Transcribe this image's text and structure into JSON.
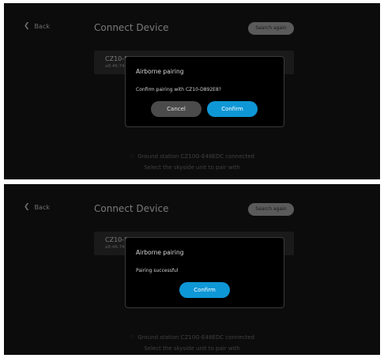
{
  "screen1": {
    "back_label": "Back",
    "title": "Connect Device",
    "search_again": "Search again",
    "device": {
      "name": "CZ10-D",
      "mac": "a8:46:74"
    },
    "dialog": {
      "title": "Airborne pairing",
      "message": "Confirm pairing with CZ10-D892E8?",
      "cancel": "Cancel",
      "confirm": "Confirm"
    },
    "status_line1": "Ground station CZ10G-E48EDC connected",
    "status_line2": "Select the skyside unit to pair with"
  },
  "screen2": {
    "back_label": "Back",
    "title": "Connect Device",
    "search_again": "Search again",
    "device": {
      "name": "CZ10-D",
      "mac": "a8:46:74"
    },
    "dialog": {
      "title": "Airborne pairing",
      "message": "Pairing successful",
      "confirm": "Confirm"
    },
    "status_line1": "Ground station CZ10G-E48EDC connected",
    "status_line2": "Select the skyside unit to pair with"
  },
  "colors": {
    "background": "#0c0c0c",
    "accent": "#0e97d6",
    "cancel_button": "#4b4b4b",
    "search_button": "#5a5a5a"
  },
  "icons": [
    "chevron-left-icon",
    "heart-icon"
  ]
}
